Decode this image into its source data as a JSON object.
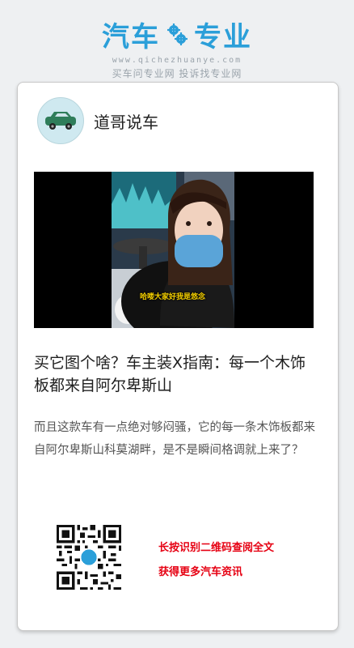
{
  "header": {
    "logo_left": "汽车",
    "logo_right": "专业",
    "domain": "www.qichezhuanye.com",
    "slogan": "买车问专业网 投诉找专业网"
  },
  "post": {
    "author": "道哥说车",
    "video_caption": "哈喽大家好我是悠念",
    "title": "买它图个啥？车主装X指南：每一个木饰板都来自阿尔卑斯山",
    "description": "而且这款车有一点绝对够闷骚，它的每一条木饰板都来自阿尔卑斯山科莫湖畔，是不是瞬间格调就上来了？"
  },
  "cta": {
    "line1": "长按识别二维码查阅全文",
    "line2": "获得更多汽车资讯"
  },
  "colors": {
    "brand": "#2b9fd9",
    "cta": "#e60012"
  }
}
